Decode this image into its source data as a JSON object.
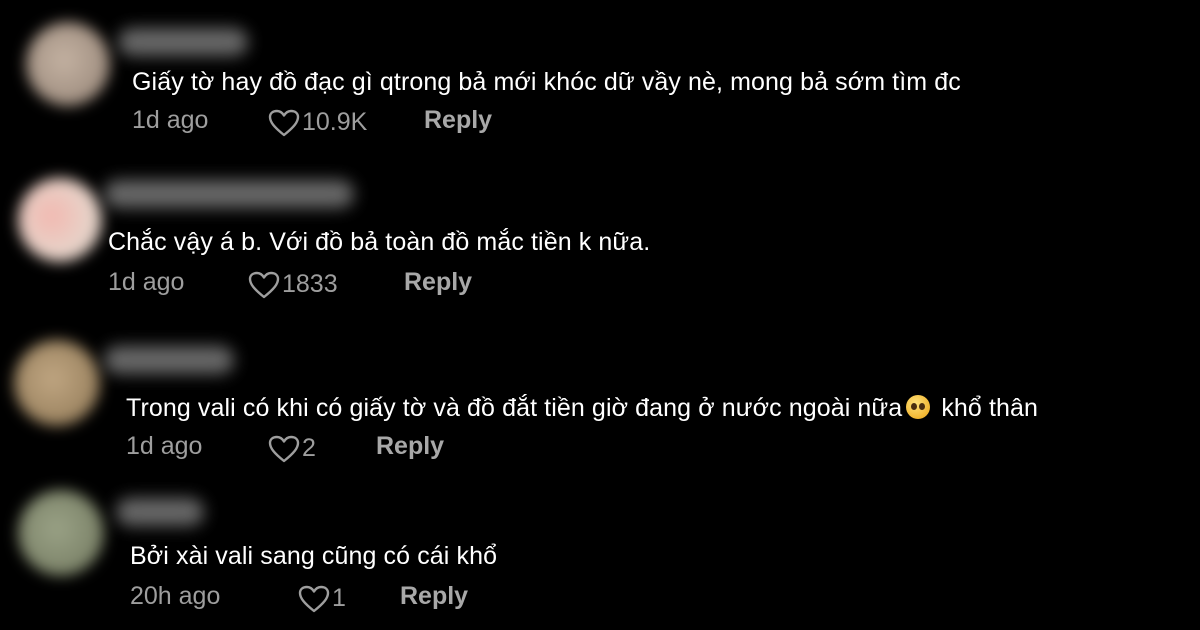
{
  "comments": [
    {
      "text": "Giấy tờ hay đồ đạc gì qtrong bả mới khóc dữ vầy nè, mong bả sớm tìm đc",
      "time": "1d ago",
      "likes": "10.9K",
      "reply_label": "Reply",
      "avatar_color": "#b8a89a"
    },
    {
      "text": "Chắc vậy á b. Với đồ bả toàn đồ mắc tiền k nữa.",
      "time": "1d ago",
      "likes": "1833",
      "reply_label": "Reply",
      "avatar_color": "#e8c8c0"
    },
    {
      "text_before_emoji": "Trong vali có khi có giấy tờ và đồ đắt tiền giờ đang ở nước ngoài nữa",
      "emoji": "pleading-face-emoji",
      "text_after_emoji": "khổ thân",
      "time": "1d ago",
      "likes": "2",
      "reply_label": "Reply",
      "avatar_color": "#a89070"
    },
    {
      "text": "Bởi xài vali sang cũng có cái khổ",
      "time": "20h ago",
      "likes": "1",
      "reply_label": "Reply",
      "avatar_color": "#8a9078"
    }
  ],
  "icons": {
    "like": "heart-outline-icon"
  },
  "colors": {
    "background": "#000000",
    "text": "#ffffff",
    "meta": "#9e9e9e"
  }
}
